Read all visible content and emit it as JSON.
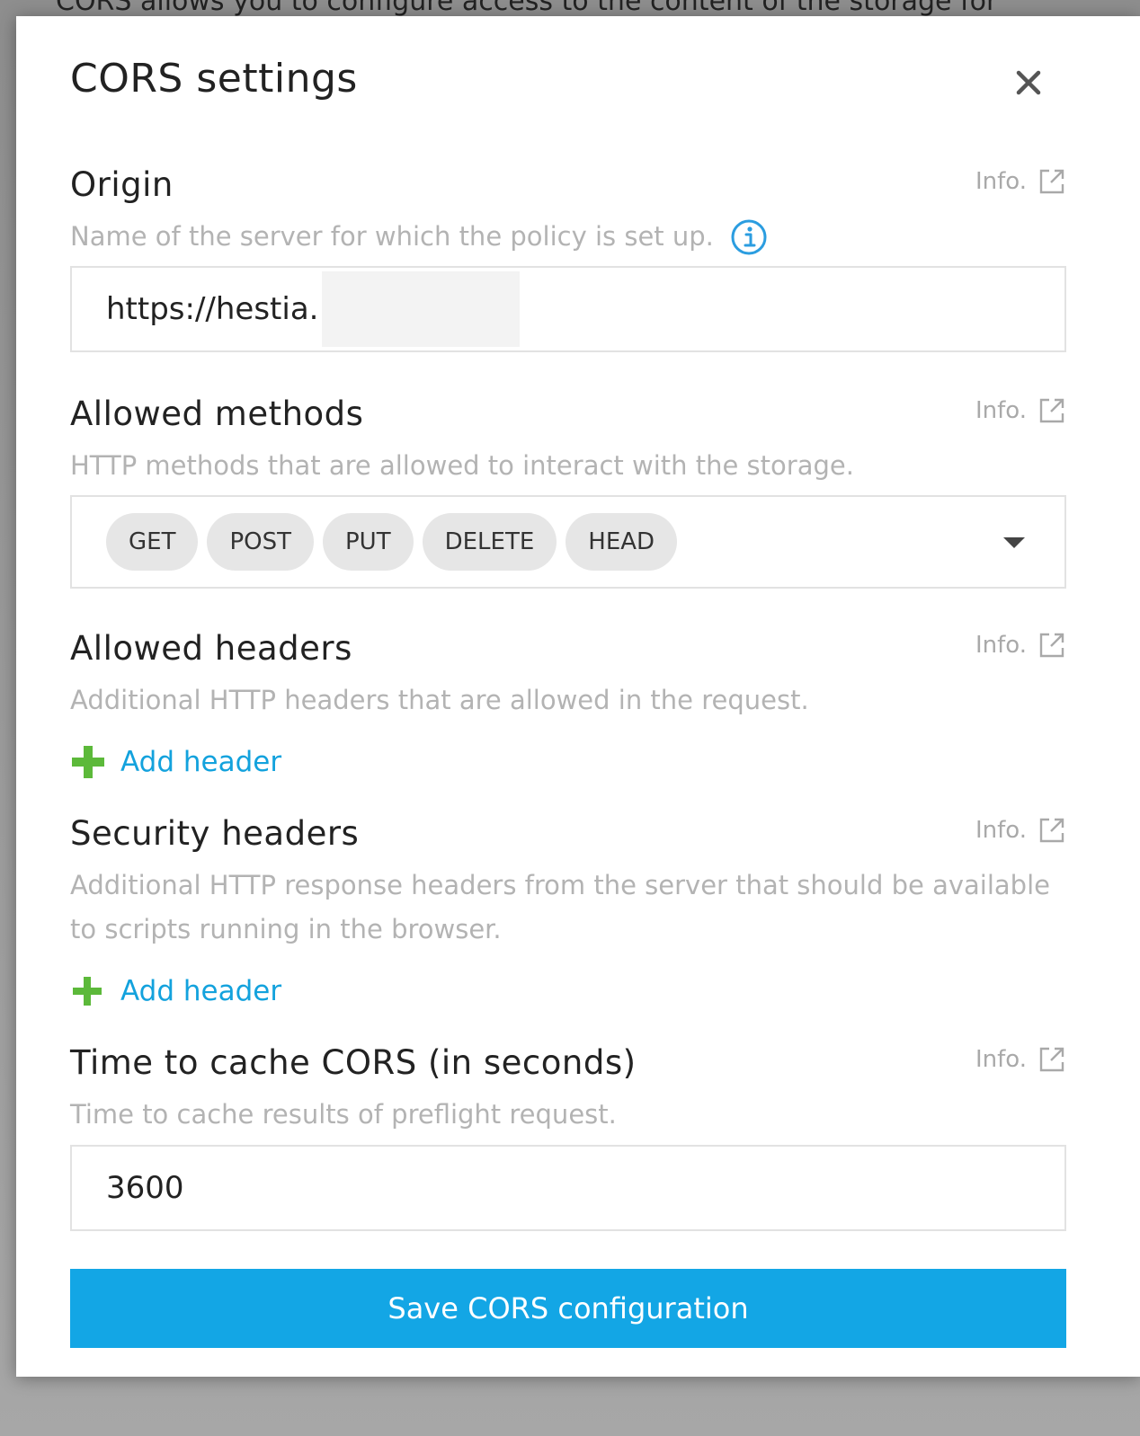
{
  "background": {
    "partial_text": "CORS allows you to configure access to the content of the storage for"
  },
  "dialog": {
    "title": "CORS settings"
  },
  "sections": {
    "origin": {
      "title": "Origin",
      "info_label": "Info.",
      "description": "Name of the server for which the policy is set up.",
      "value": "https://hestia."
    },
    "allowed_methods": {
      "title": "Allowed methods",
      "info_label": "Info.",
      "description": "HTTP methods that are allowed to interact with the storage.",
      "methods": [
        "GET",
        "POST",
        "PUT",
        "DELETE",
        "HEAD"
      ]
    },
    "allowed_headers": {
      "title": "Allowed headers",
      "info_label": "Info.",
      "description": "Additional HTTP headers that are allowed in the request.",
      "add_label": "Add header"
    },
    "security_headers": {
      "title": "Security headers",
      "info_label": "Info.",
      "description_line1": "Additional HTTP response headers from the server that should be available",
      "description_line2": "to scripts running in the browser.",
      "add_label": "Add header"
    },
    "cache_time": {
      "title": "Time to cache CORS (in seconds)",
      "info_label": "Info.",
      "description": "Time to cache results of preflight request.",
      "value": "3600"
    }
  },
  "save_button": {
    "label": "Save CORS configuration"
  },
  "colors": {
    "accent": "#13a6e5",
    "link": "#13a2dd",
    "add_icon": "#5cb93a",
    "info_icon": "#2b9de0"
  },
  "icons": {
    "close": "close-icon",
    "info": "info-circle-icon",
    "external": "external-link-icon",
    "add": "plus-icon",
    "dropdown": "caret-down-icon"
  }
}
